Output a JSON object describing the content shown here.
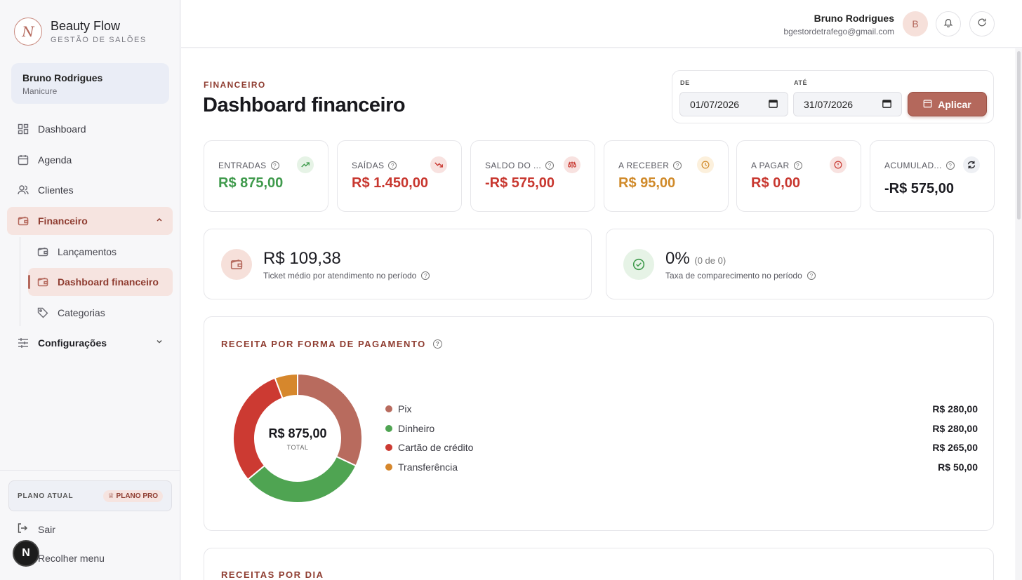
{
  "brand": {
    "name": "Beauty Flow",
    "subtitle": "GESTÃO DE SALÕES",
    "logo_letter": "N"
  },
  "sidebar": {
    "user": {
      "name": "Bruno Rodrigues",
      "role": "Manicure"
    },
    "items": [
      {
        "label": "Dashboard",
        "icon": "grid-icon"
      },
      {
        "label": "Agenda",
        "icon": "calendar-icon"
      },
      {
        "label": "Clientes",
        "icon": "users-icon"
      },
      {
        "label": "Financeiro",
        "icon": "wallet-icon"
      },
      {
        "label": "Configurações",
        "icon": "sliders-icon"
      }
    ],
    "subitems": [
      {
        "label": "Lançamentos",
        "icon": "wallet-icon"
      },
      {
        "label": "Dashboard financeiro",
        "icon": "wallet-icon"
      },
      {
        "label": "Categorias",
        "icon": "tag-icon"
      }
    ],
    "plan": {
      "label": "PLANO ATUAL",
      "badge": "PLANO PRO"
    },
    "logout": "Sair",
    "collapse": "Recolher menu",
    "bottom_badge": "N"
  },
  "topbar": {
    "user_name": "Bruno Rodrigues",
    "user_email": "bgestordetrafego@gmail.com",
    "avatar_letter": "B"
  },
  "page": {
    "eyebrow": "FINANCEIRO",
    "title": "Dashboard financeiro"
  },
  "filters": {
    "from_label": "DE",
    "from_value": "01/07/2026",
    "to_label": "ATÉ",
    "to_value": "31/07/2026",
    "apply_label": "Aplicar"
  },
  "kpis": [
    {
      "label": "ENTRADAS",
      "value": "R$ 875,00",
      "color": "#3f9a4c",
      "icon": "trending-up-icon"
    },
    {
      "label": "SAÍDAS",
      "value": "R$ 1.450,00",
      "color": "#c8372f",
      "icon": "trending-down-icon"
    },
    {
      "label": "SALDO DO ...",
      "value": "-R$ 575,00",
      "color": "#c8372f",
      "icon": "scale-icon"
    },
    {
      "label": "A RECEBER",
      "value": "R$ 95,00",
      "color": "#d08a2a",
      "icon": "clock-icon"
    },
    {
      "label": "A PAGAR",
      "value": "R$ 0,00",
      "color": "#c8372f",
      "icon": "alert-icon"
    },
    {
      "label": "ACUMULAD...",
      "value": "-R$ 575,00",
      "color": "#1c1c22",
      "icon": "refresh-icon"
    }
  ],
  "ticket": {
    "value": "R$ 109,38",
    "desc": "Ticket médio por atendimento no período"
  },
  "attendance": {
    "value": "0%",
    "detail": "(0 de 0)",
    "desc": "Taxa de comparecimento no período"
  },
  "payment_panel": {
    "title": "RECEITA POR FORMA DE PAGAMENTO",
    "total": "R$ 875,00",
    "total_label": "TOTAL",
    "methods": [
      {
        "name": "Pix",
        "value": "R$ 280,00",
        "amount": 280,
        "color": "#b86b5e"
      },
      {
        "name": "Dinheiro",
        "value": "R$ 280,00",
        "amount": 280,
        "color": "#4fa452"
      },
      {
        "name": "Cartão de crédito",
        "value": "R$ 265,00",
        "amount": 265,
        "color": "#cc3a32"
      },
      {
        "name": "Transferência",
        "value": "R$ 50,00",
        "amount": 50,
        "color": "#d6872c"
      }
    ]
  },
  "daily_panel": {
    "title": "RECEITAS POR DIA"
  }
}
